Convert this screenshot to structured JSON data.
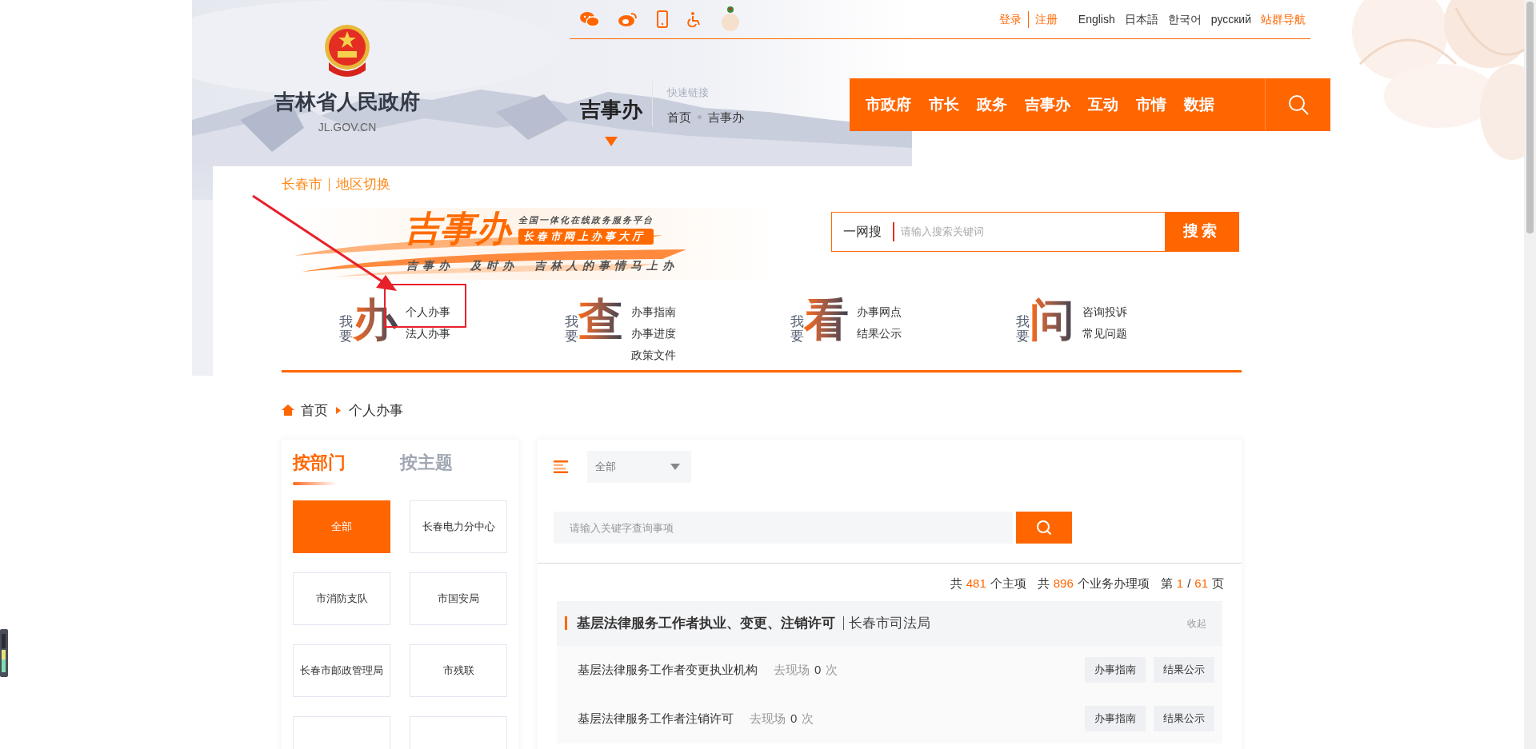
{
  "top_bar": {
    "auth_links": [
      "登录",
      "注册"
    ],
    "languages": [
      "English",
      "日本語",
      "한국어",
      "русский"
    ],
    "site_nav": "站群导航"
  },
  "site": {
    "title": "吉林省人民政府",
    "domain": "JL.GOV.CN"
  },
  "section_title": "吉事办",
  "quick_links": {
    "label": "快速链接",
    "items": [
      "首页",
      "吉事办"
    ]
  },
  "main_nav": [
    "市政府",
    "市长",
    "政务",
    "吉事办",
    "互动",
    "市情",
    "数据"
  ],
  "region": {
    "city": "长春市",
    "switch": "地区切换"
  },
  "banner": {
    "brand": "吉事办",
    "tagline": "全国一体化在线政务服务平台",
    "badge": "长春市网上办事大厅",
    "slogan": "吉事办　及时办　吉林人的事情马上办"
  },
  "site_search": {
    "label": "一网搜",
    "placeholder": "请输入搜索关键词",
    "button": "搜索"
  },
  "services": [
    {
      "prefix": "我要",
      "glyph": "办",
      "links": [
        "个人办事",
        "法人办事"
      ]
    },
    {
      "prefix": "我要",
      "glyph": "查",
      "links": [
        "办事指南",
        "办事进度",
        "政策文件"
      ]
    },
    {
      "prefix": "我要",
      "glyph": "看",
      "links": [
        "办事网点",
        "结果公示"
      ]
    },
    {
      "prefix": "我要",
      "glyph": "问",
      "links": [
        "咨询投诉",
        "常见问题"
      ]
    }
  ],
  "breadcrumb": [
    "首页",
    "个人办事"
  ],
  "filter_tabs": [
    {
      "label": "按部门",
      "selected": true
    },
    {
      "label": "按主题",
      "selected": false
    }
  ],
  "departments": [
    {
      "label": "全部",
      "selected": true
    },
    {
      "label": "长春电力分中心",
      "selected": false
    },
    {
      "label": "市消防支队",
      "selected": false
    },
    {
      "label": "市国安局",
      "selected": false
    },
    {
      "label": "长春市邮政管理局",
      "selected": false
    },
    {
      "label": "市残联",
      "selected": false
    }
  ],
  "list_panel": {
    "category_select": "全部",
    "search_placeholder": "请输入关键字查询事项",
    "stats": [
      {
        "text": "共",
        "highlight": false
      },
      {
        "text": "481",
        "highlight": true
      },
      {
        "text": "个主项",
        "highlight": false
      },
      {
        "text": "共",
        "highlight": false
      },
      {
        "text": "896",
        "highlight": true
      },
      {
        "text": "个业务办理项",
        "highlight": false
      },
      {
        "text": "第",
        "highlight": false
      },
      {
        "text": "1",
        "highlight": true
      },
      {
        "text": "/",
        "highlight": false
      },
      {
        "text": "61",
        "highlight": true
      },
      {
        "text": "页",
        "highlight": false
      }
    ],
    "groups": [
      {
        "title": "基层法律服务工作者执业、变更、注销许可",
        "department": "长春市司法局",
        "toggle": "收起",
        "items": [
          {
            "name": "基层法律服务工作者变更执业机构",
            "visits_label": "去现场",
            "visits": "0",
            "visits_unit": "次",
            "actions": [
              "办事指南",
              "结果公示"
            ]
          },
          {
            "name": "基层法律服务工作者注销许可",
            "visits_label": "去现场",
            "visits": "0",
            "visits_unit": "次",
            "actions": [
              "办事指南",
              "结果公示"
            ]
          }
        ]
      }
    ]
  }
}
